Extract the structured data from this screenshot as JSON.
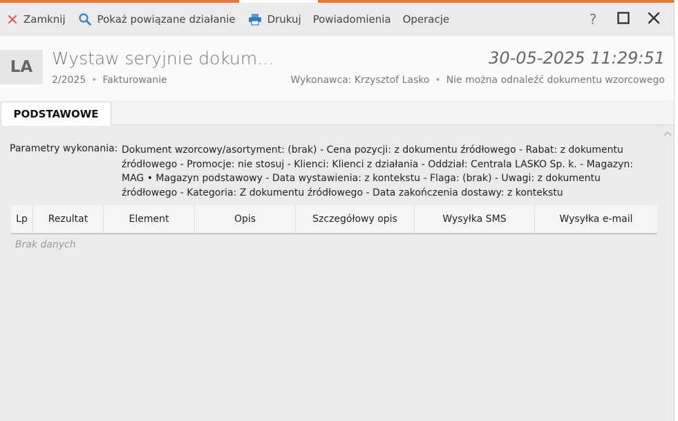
{
  "toolbar": {
    "close_label": "Zamknij",
    "related_label": "Pokaż powiązane działanie",
    "print_label": "Drukuj",
    "notifications_label": "Powiadomienia",
    "operations_label": "Operacje",
    "help_label": "?"
  },
  "header": {
    "avatar": "LA",
    "title": "Wystaw seryjnie dokum...",
    "number": "2/2025",
    "category": "Fakturowanie",
    "date": "30-05-2025 11:29:51",
    "executor": "Wykonawca: Krzysztof Lasko",
    "status": "Nie można odnaleźć dokumentu wzorcowego"
  },
  "tabs": [
    {
      "label": "PODSTAWOWE",
      "active": true
    }
  ],
  "params": {
    "label": "Parametry wykonania:",
    "text": "Dokument wzorcowy/asortyment: (brak) - Cena pozycji: z dokumentu źródłowego - Rabat: z dokumentu źródłowego - Promocje: nie stosuj - Klienci: Klienci z działania - Oddział: Centrala LASKO Sp. k. - Magazyn: MAG • Magazyn podstawowy - Data wystawienia: z kontekstu - Flaga: (brak) - Uwagi: z dokumentu źródłowego - Kategoria: Z dokumentu źródłowego - Data zakończenia dostawy: z kontekstu"
  },
  "table": {
    "columns": [
      "Lp",
      "Rezultat",
      "Element",
      "Opis",
      "Szczegółowy opis",
      "Wysyłka SMS",
      "Wysyłka e-mail"
    ],
    "empty_text": "Brak danych"
  },
  "colors": {
    "accent": "#e8772e",
    "close_icon": "#e05a5a",
    "icon_blue": "#2d7fc1"
  },
  "icons": {
    "close": "close-icon",
    "related": "search-icon",
    "print": "printer-icon",
    "help": "help-icon",
    "maximize": "maximize-icon",
    "window_close": "window-close-icon",
    "collapse": "chevron-up-icon"
  }
}
